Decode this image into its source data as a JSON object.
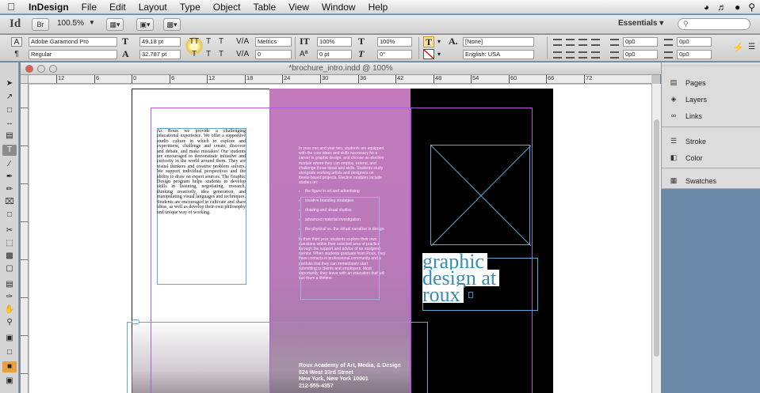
{
  "menubar": {
    "items": [
      "InDesign",
      "File",
      "Edit",
      "Layout",
      "Type",
      "Object",
      "Table",
      "View",
      "Window",
      "Help"
    ],
    "right_icons": [
      "wifi-icon",
      "volume-icon",
      "user-icon",
      "spotlight-icon"
    ]
  },
  "appbar": {
    "logo": "Id",
    "zoom": "100.5%",
    "br_label": "Br",
    "workspace": "Essentials",
    "search_placeholder": ""
  },
  "control": {
    "font_family": "Adobe Garamond Pro",
    "font_style": "Regular",
    "font_size": "49.18 pt",
    "leading": "32.787 pt",
    "kerning": "Metrics",
    "tracking": "0",
    "vertical_scale": "100%",
    "horizontal_scale": "100%",
    "baseline_shift": "0 pt",
    "skew": "0°",
    "char_style": "[None]",
    "language": "English: USA",
    "indent_left": "0p0",
    "indent_right": "0p0",
    "space_before": "0p0",
    "space_after": "0p0",
    "first_indent": "0p0",
    "last_indent": "0p0",
    "tt_labels": [
      "TT",
      "T",
      "T",
      "T",
      "T",
      "T"
    ]
  },
  "document": {
    "title": "*brochure_intro.indd @ 100%",
    "ruler_h": [
      "12",
      "6",
      "0",
      "6",
      "12",
      "18",
      "24",
      "30",
      "36",
      "42",
      "48",
      "54",
      "60",
      "66",
      "72"
    ]
  },
  "page": {
    "body_text": "As Roux we provide a challenging educational experience. We offer a supportive studio culture in which to explore and experiment, challenge and create, discover and debate, and make mistakes! Our students are encouraged to demonstrate initiative and curiosity in the world around them. They are visual thinkers and creative problem solvers. We support individual perspectives and the ability to draw on expert sources. The Graphic Design program helps students to develop skills in listening, negotiating, research, thinking creatively, idea generation, and manipulating visual languages and techniques. Students are encouraged to cultivate and share ideas, as well as develop their own philosophy and unique way of working.",
    "pink_intro": "In year one and year two, students are equipped with the core ideas and skills necessary for a career in graphic design, and choose an elective module where they can employ, extend, and challenge those ideas and skills. Students study alongside working artists and designers on thesis-based projects. Elective modules include studies on:",
    "pink_bullets": [
      "the figure in art and advertising",
      "creative branding strategies",
      "drawing and visual studies",
      "advanced material investigation",
      "the physical vs. the virtual narrative in design"
    ],
    "pink_outro": "In their third year, students explore their own questions within their selected area of practice through the support and advice of an assigned mentor. When students graduate from Roux, they have contacts in professional community and a portfolio that they can immediately start submitting to clients and employers. Most importantly, they leave with an education that will last them a lifetime.",
    "address_lines": [
      "Roux Academy of Art, Media, & Design",
      "824 West 33rd Street",
      "New York, New York 10001",
      "212-555-4357"
    ],
    "headline_lines": [
      "graphic",
      "design at",
      "roux"
    ]
  },
  "right_panel": {
    "group1": [
      "Pages",
      "Layers",
      "Links"
    ],
    "group2": [
      "Stroke",
      "Color"
    ],
    "group3": [
      "Swatches"
    ]
  },
  "colors": {
    "pink_panel": "#c27abd",
    "black_panel": "#000000",
    "headline": "#3a8bb5",
    "margin_guide": "#b05cd6",
    "frame_selection": "#5ea9d4"
  }
}
